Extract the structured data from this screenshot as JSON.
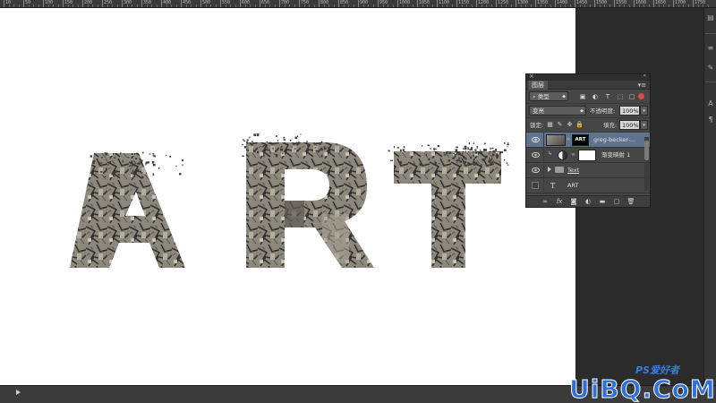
{
  "ruler": {
    "labels": [
      "10",
      "50",
      "100",
      "150",
      "200",
      "250",
      "300",
      "350",
      "400",
      "450",
      "500",
      "550",
      "600",
      "650",
      "700",
      "750",
      "800",
      "850",
      "900",
      "950",
      "1000",
      "1050",
      "1100",
      "1150",
      "1200",
      "1250",
      "1300",
      "1350",
      "1400",
      "1450",
      "1500",
      "1550",
      "1600",
      "1650",
      "1700",
      "1750"
    ]
  },
  "canvas": {
    "art_text": "ART",
    "texture_colors": [
      "#4a4a48",
      "#6b6861",
      "#8f8a80",
      "#3a3936",
      "#a39e92",
      "#5b5a55"
    ]
  },
  "layers_panel": {
    "tab_label": "图层",
    "filter": {
      "selected": "类型",
      "icons": [
        "image-filter-icon",
        "adjustment-filter-icon",
        "type-filter-icon",
        "shape-filter-icon",
        "smart-object-filter-icon"
      ]
    },
    "blend_mode": "变亮",
    "opacity_label": "不透明度:",
    "opacity_value": "100%",
    "lock_label": "锁定:",
    "fill_label": "填充:",
    "fill_value": "100%",
    "layers": [
      {
        "name": "greg-becker-...",
        "thumb_text": "ART",
        "visible": true,
        "selected": true
      },
      {
        "name": "渐变映射 1",
        "visible": true,
        "selected": false
      },
      {
        "name": "Text",
        "visible": true,
        "selected": false
      },
      {
        "name": "ART",
        "visible": false,
        "selected": false
      }
    ]
  },
  "watermark": {
    "brand": "UiBQ.CoM",
    "top": "PS爱好者"
  },
  "colors": {
    "selection": "#5f728e",
    "panel_bg": "#464646",
    "toggle": "#e04c4c",
    "watermark": "#2f6fd6"
  }
}
